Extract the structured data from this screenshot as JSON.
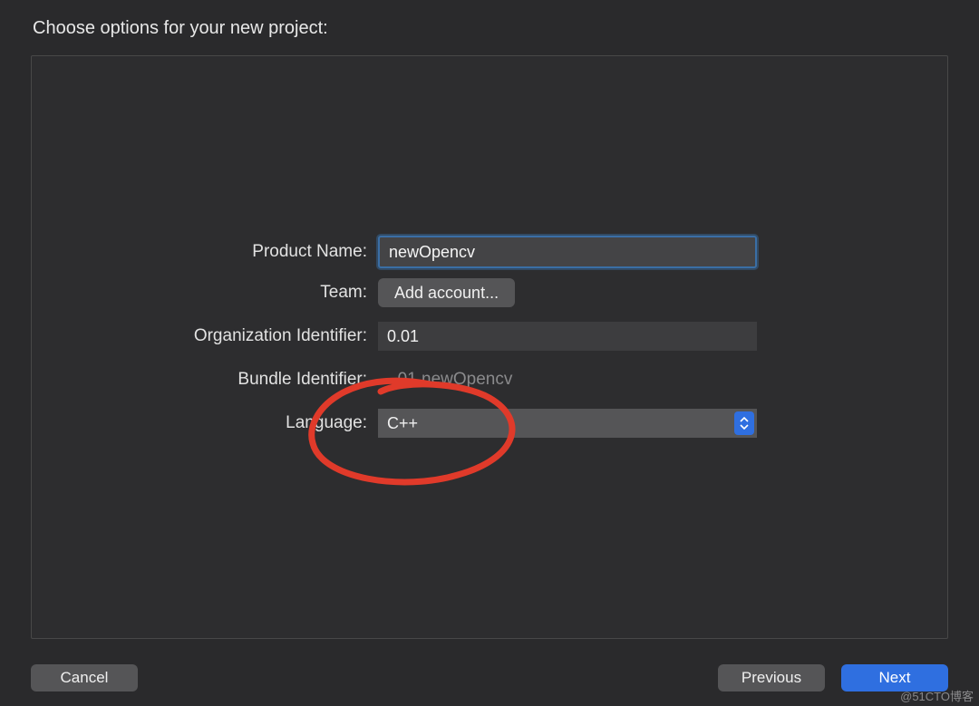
{
  "header": {
    "title": "Choose options for your new project:"
  },
  "form": {
    "productName": {
      "label": "Product Name:",
      "value": "newOpencv"
    },
    "team": {
      "label": "Team:",
      "buttonLabel": "Add account..."
    },
    "orgId": {
      "label": "Organization Identifier:",
      "value": "0.01"
    },
    "bundleId": {
      "label": "Bundle Identifier:",
      "value": "-.01.newOpencv"
    },
    "language": {
      "label": "Language:",
      "value": "C++"
    }
  },
  "footer": {
    "cancel": "Cancel",
    "previous": "Previous",
    "next": "Next"
  },
  "watermark": "@51CTO博客"
}
